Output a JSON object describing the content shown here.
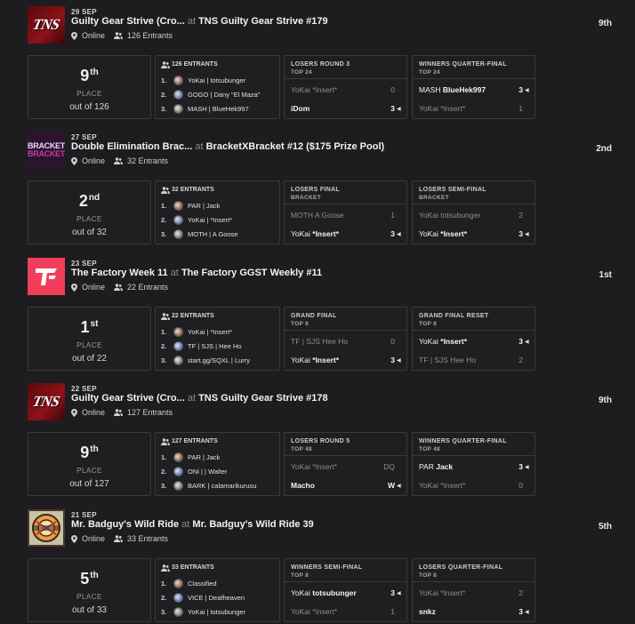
{
  "events": [
    {
      "logo": "TNS",
      "date": "29 SEP",
      "title": "Guilty Gear Strive (Cro...",
      "at": "at",
      "tournament": "TNS Guilty Gear Strive #179",
      "status": "Online",
      "entrants": "126 Entrants",
      "placing": "9th",
      "place_num": "9",
      "place_suffix": "th",
      "place_label": "PLACE",
      "place_out": "out of 126",
      "entrant_header": "126 ENTRANTS",
      "top": [
        {
          "rank": "1.",
          "name": "YoKai | totsubunger"
        },
        {
          "rank": "2.",
          "name": "GOGO | Dany \"El Maza\""
        },
        {
          "rank": "3.",
          "name": "MASH | BlueHek997"
        }
      ],
      "sets": [
        {
          "round": "LOSERS ROUND 3",
          "sub": "TOP 24",
          "rows": [
            {
              "prefix": "",
              "tag": "YoKai *Insert*",
              "score": "0",
              "win": false
            },
            {
              "prefix": "",
              "tag": "iDom",
              "score": "3",
              "win": true
            }
          ]
        },
        {
          "round": "WINNERS QUARTER-FINAL",
          "sub": "TOP 24",
          "rows": [
            {
              "prefix": "MASH ",
              "tag": "BlueHek997",
              "score": "3",
              "win": true
            },
            {
              "prefix": "",
              "tag": "YoKai *Insert*",
              "score": "1",
              "win": false
            }
          ]
        }
      ]
    },
    {
      "logo": "BRACKET",
      "date": "27 SEP",
      "title": "Double Elimination Brac...",
      "at": "at",
      "tournament": "BracketXBracket #12 ($175 Prize Pool)",
      "status": "Online",
      "entrants": "32 Entrants",
      "placing": "2nd",
      "place_num": "2",
      "place_suffix": "nd",
      "place_label": "PLACE",
      "place_out": "out of 32",
      "entrant_header": "32 ENTRANTS",
      "top": [
        {
          "rank": "1.",
          "name": "PAR | Jack"
        },
        {
          "rank": "2.",
          "name": "YoKai | *Insert*"
        },
        {
          "rank": "3.",
          "name": "MOTH | A Goose"
        }
      ],
      "sets": [
        {
          "round": "LOSERS FINAL",
          "sub": "BRACKET",
          "rows": [
            {
              "prefix": "MOTH ",
              "tag": "A Goose",
              "score": "1",
              "win": false
            },
            {
              "prefix": "YoKai ",
              "tag": "*Insert*",
              "score": "3",
              "win": true
            }
          ]
        },
        {
          "round": "LOSERS SEMI-FINAL",
          "sub": "BRACKET",
          "rows": [
            {
              "prefix": "YoKai ",
              "tag": "totsubunger",
              "score": "2",
              "win": false
            },
            {
              "prefix": "YoKai ",
              "tag": "*Insert*",
              "score": "3",
              "win": true
            }
          ]
        }
      ]
    },
    {
      "logo": "TF",
      "date": "23 SEP",
      "title": "The Factory Week 11",
      "at": "at",
      "tournament": "The Factory GGST Weekly #11",
      "status": "Online",
      "entrants": "22 Entrants",
      "placing": "1st",
      "place_num": "1",
      "place_suffix": "st",
      "place_label": "PLACE",
      "place_out": "out of 22",
      "entrant_header": "22 ENTRANTS",
      "top": [
        {
          "rank": "1.",
          "name": "YoKai | *Insert*"
        },
        {
          "rank": "2.",
          "name": "TF | SJS | Hee Ho"
        },
        {
          "rank": "3.",
          "name": "start.gg/SQXL | Lurry"
        }
      ],
      "sets": [
        {
          "round": "GRAND FINAL",
          "sub": "TOP 8",
          "rows": [
            {
              "prefix": "TF | SJS ",
              "tag": "Hee Ho",
              "score": "0",
              "win": false
            },
            {
              "prefix": "YoKai ",
              "tag": "*Insert*",
              "score": "3",
              "win": true
            }
          ]
        },
        {
          "round": "GRAND FINAL RESET",
          "sub": "TOP 8",
          "rows": [
            {
              "prefix": "YoKai ",
              "tag": "*Insert*",
              "score": "3",
              "win": true
            },
            {
              "prefix": "TF | SJS ",
              "tag": "Hee Ho",
              "score": "2",
              "win": false
            }
          ]
        }
      ]
    },
    {
      "logo": "TNS",
      "date": "22 SEP",
      "title": "Guilty Gear Strive (Cro...",
      "at": "at",
      "tournament": "TNS Guilty Gear Strive #178",
      "status": "Online",
      "entrants": "127 Entrants",
      "placing": "9th",
      "place_num": "9",
      "place_suffix": "th",
      "place_label": "PLACE",
      "place_out": "out of 127",
      "entrant_header": "127 ENTRANTS",
      "top": [
        {
          "rank": "1.",
          "name": "PAR | Jack"
        },
        {
          "rank": "2.",
          "name": "ONi | | Walter"
        },
        {
          "rank": "3.",
          "name": "BARK | calamarikurusu"
        }
      ],
      "sets": [
        {
          "round": "LOSERS ROUND 5",
          "sub": "TOP 48",
          "rows": [
            {
              "prefix": "YoKai ",
              "tag": "*Insert*",
              "score": "DQ",
              "win": false
            },
            {
              "prefix": "",
              "tag": "Macho",
              "score": "W",
              "win": true
            }
          ]
        },
        {
          "round": "WINNERS QUARTER-FINAL",
          "sub": "TOP 48",
          "rows": [
            {
              "prefix": "PAR ",
              "tag": "Jack",
              "score": "3",
              "win": true
            },
            {
              "prefix": "YoKai ",
              "tag": "*Insert*",
              "score": "0",
              "win": false
            }
          ]
        }
      ]
    },
    {
      "logo": "MB",
      "date": "21 SEP",
      "title": "Mr. Badguy's Wild Ride",
      "at": "at",
      "tournament": "Mr. Badguy's Wild Ride 39",
      "status": "Online",
      "entrants": "33 Entrants",
      "placing": "5th",
      "place_num": "5",
      "place_suffix": "th",
      "place_label": "PLACE",
      "place_out": "out of 33",
      "entrant_header": "33 ENTRANTS",
      "top": [
        {
          "rank": "1.",
          "name": "Classified"
        },
        {
          "rank": "2.",
          "name": "VICE | Deafheaven"
        },
        {
          "rank": "3.",
          "name": "YoKai | totsubunger"
        }
      ],
      "sets": [
        {
          "round": "WINNERS SEMI-FINAL",
          "sub": "TOP 8",
          "rows": [
            {
              "prefix": "YoKai ",
              "tag": "totsubunger",
              "score": "3",
              "win": true
            },
            {
              "prefix": "YoKai ",
              "tag": "*Insert*",
              "score": "1",
              "win": false
            }
          ]
        },
        {
          "round": "LOSERS QUARTER-FINAL",
          "sub": "TOP 8",
          "rows": [
            {
              "prefix": "YoKai ",
              "tag": "*Insert*",
              "score": "2",
              "win": false
            },
            {
              "prefix": "",
              "tag": "snkz",
              "score": "3",
              "win": true
            }
          ]
        }
      ]
    }
  ],
  "colors": {
    "background": "#1d1d1f",
    "card_border": "#3a3a3c",
    "tns_red": "#8e1118",
    "factory_pink": "#f23e5b",
    "bracket_purple": "#c23b9b"
  },
  "icons": {
    "status": "map-pin-icon",
    "entrants": "people-icon",
    "winner_marker": "caret-left-icon"
  }
}
